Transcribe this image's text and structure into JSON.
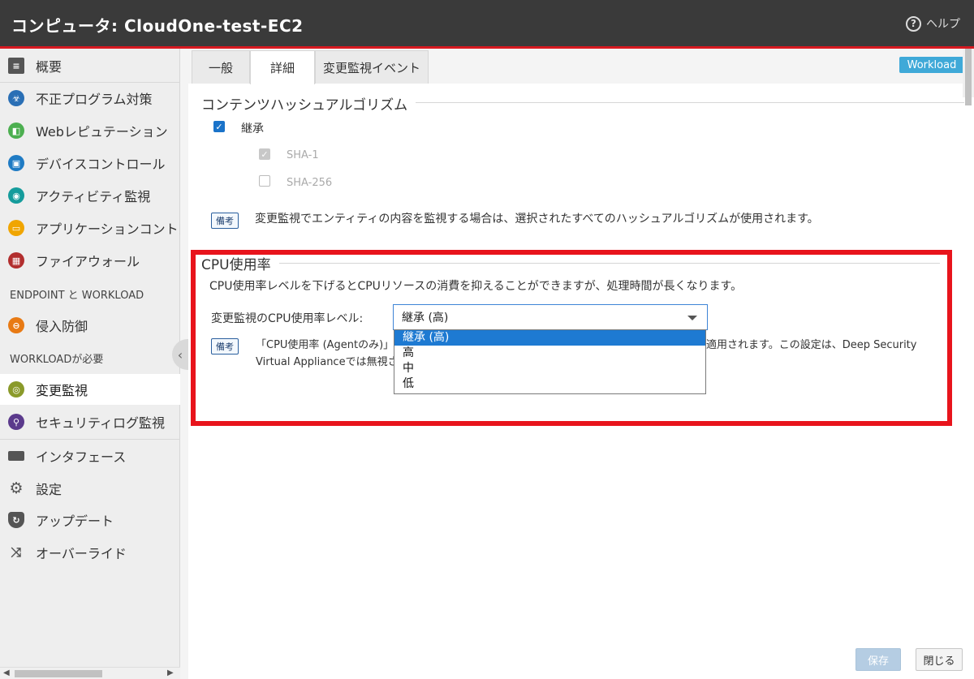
{
  "window": {
    "title": "コンピュータ: CloudOne-test-EC2",
    "help_label": "ヘルプ",
    "help_icon": "question-circle-icon"
  },
  "sidebar": {
    "items": [
      {
        "label": "概要",
        "icon": "overview-icon",
        "color": "#555555"
      },
      {
        "label": "不正プログラム対策",
        "icon": "biohazard-icon",
        "color": "#2a6fb5"
      },
      {
        "label": "Webレピュテーション",
        "icon": "web-reputation-icon",
        "color": "#4caf50"
      },
      {
        "label": "デバイスコントロール",
        "icon": "device-control-icon",
        "color": "#1f7bc4"
      },
      {
        "label": "アクティビティ監視",
        "icon": "activity-monitor-icon",
        "color": "#159c9c"
      },
      {
        "label": "アプリケーションコントロール",
        "icon": "app-control-icon",
        "color": "#f0a500"
      },
      {
        "label": "ファイアウォール",
        "icon": "firewall-icon",
        "color": "#b22e2e"
      },
      {
        "label": "侵入防御",
        "icon": "intrusion-prevention-icon",
        "color": "#e87a14"
      },
      {
        "label": "変更監視",
        "icon": "integrity-monitor-icon",
        "color": "#8a9a2a"
      },
      {
        "label": "セキュリティログ監視",
        "icon": "log-inspection-icon",
        "color": "#5b3a8c"
      },
      {
        "label": "インタフェース",
        "icon": "interface-icon",
        "color": "#555555"
      },
      {
        "label": "設定",
        "icon": "gear-icon",
        "color": "#555555"
      },
      {
        "label": "アップデート",
        "icon": "shield-update-icon",
        "color": "#555555"
      },
      {
        "label": "オーバーライド",
        "icon": "shuffle-icon",
        "color": "#555555"
      }
    ],
    "headers": {
      "endpoint_workload": "ENDPOINT と WORKLOAD",
      "workload_required": "WORKLOADが必要"
    }
  },
  "tabs": [
    {
      "label": "一般"
    },
    {
      "label": "詳細"
    },
    {
      "label": "変更監視イベント"
    }
  ],
  "active_tab": "詳細",
  "badge": "Workload",
  "hash_section": {
    "title": "コンテンツハッシュアルゴリズム",
    "inherit_label": "継承",
    "sha1_label": "SHA-1",
    "sha256_label": "SHA-256",
    "note_badge": "備考",
    "note_text": "変更監視でエンティティの内容を監視する場合は、選択されたすべてのハッシュアルゴリズムが使用されます。"
  },
  "cpu_section": {
    "title": "CPU使用率",
    "description": "CPU使用率レベルを下げるとCPUリソースの消費を抑えることができますが、処理時間が長くなります。",
    "level_label": "変更監視のCPU使用率レベル:",
    "selected": "継承 (高)",
    "options": [
      "継承 (高)",
      "高",
      "中",
      "低"
    ],
    "note_badge": "備考",
    "note_line1_left": "「CPU使用率 (Agentのみ)」",
    "note_line1_right": "適用されます。この設定は、Deep Security",
    "note_line2": "Virtual Applianceでは無視さ"
  },
  "footer": {
    "save_label": "保存",
    "close_label": "閉じる"
  }
}
